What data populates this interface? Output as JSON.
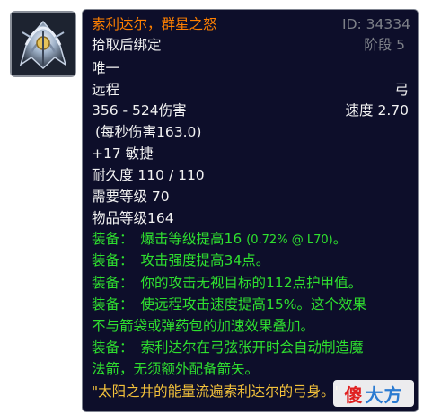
{
  "item": {
    "name": "索利达尔，群星之怒",
    "id_label": "ID: 34334",
    "bind": "拾取后绑定",
    "stage": "阶段 5",
    "unique": "唯一",
    "slot": "远程",
    "weapon_type": "弓",
    "damage": "356 - 524伤害",
    "speed": "速度 2.70",
    "dps": "(每秒伤害163.0)",
    "stat": "+17 敏捷",
    "durability": "耐久度 110 / 110",
    "required_level": "需要等级 70",
    "item_level": "物品等级164"
  },
  "equips": [
    {
      "prefix": "装备：",
      "text": "爆击等级提高16",
      "note": "(0.72% @ L70)",
      "suffix": "。"
    },
    {
      "prefix": "装备：",
      "text": "攻击强度提高34点。"
    },
    {
      "prefix": "装备：",
      "text": "你的攻击无视目标的112点护甲值。"
    },
    {
      "prefix": "装备：",
      "text": "使远程攻击速度提高15%。这个效果",
      "cont": "不与箭袋或弹药包的加速效果叠加。"
    },
    {
      "prefix": "装备：",
      "text": "索利达尔在弓弦张开时会自动制造魔",
      "cont": "法箭，无须额外配备箭矢。"
    }
  ],
  "flavor": "\"太阳之井的能量流遍索利达尔的弓身。\"",
  "watermark": {
    "part1": "傻",
    "part2": "大方"
  },
  "colors": {
    "name": "#ff8000",
    "equip": "#2fe02f",
    "flavor": "#f5c33b",
    "background": "#0d0e2a"
  },
  "icon": "bow-item-icon"
}
